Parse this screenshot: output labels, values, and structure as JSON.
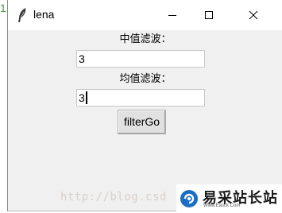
{
  "edge_mark": "1",
  "window": {
    "title": "lena",
    "controls": {
      "minimize": "minimize",
      "maximize": "maximize",
      "close": "close"
    }
  },
  "form": {
    "median_label": "中值滤波：",
    "median_value": "3",
    "mean_label": "均值滤波：",
    "mean_value": "3",
    "button_label": "filterGo"
  },
  "watermark": {
    "text": "http://blog.csd",
    "badge_name": "易采站长站",
    "badge_url": "Www.Easck.Com"
  },
  "colors": {
    "window_bg": "#f0f0f0",
    "titlebar_bg": "#ffffff",
    "badge_blue": "#1a6fc4"
  }
}
